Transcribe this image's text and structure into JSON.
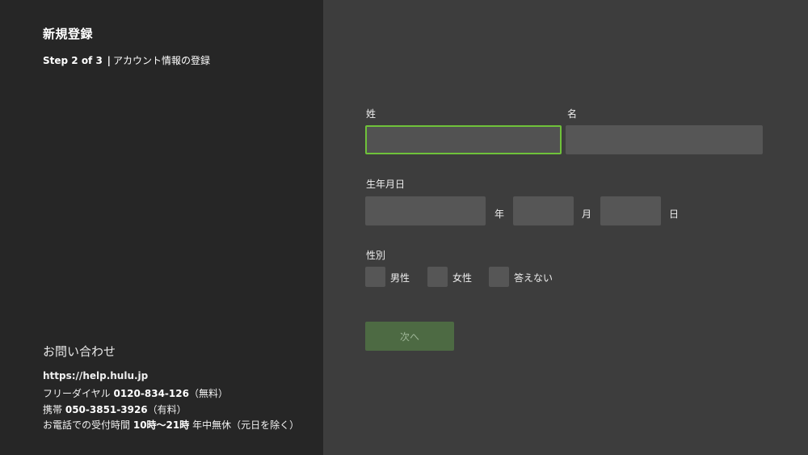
{
  "sidebar": {
    "title": "新規登録",
    "step_count": "Step 2 of 3",
    "step_separator": "|",
    "step_desc": "アカウント情報の登録",
    "contact": {
      "title": "お問い合わせ",
      "url": "https://help.hulu.jp",
      "free_dial_label": "フリーダイヤル",
      "free_dial_number": "0120-834-126",
      "free_dial_note": "（無料）",
      "mobile_label": "携帯",
      "mobile_number": "050-3851-3926",
      "mobile_note": "（有料）",
      "hours_label": "お電話での受付時間",
      "hours_time": "10時〜21時",
      "hours_note": "年中無休（元日を除く）"
    }
  },
  "form": {
    "last_name_label": "姓",
    "last_name_value": "",
    "first_name_label": "名",
    "first_name_value": "",
    "birthdate_label": "生年月日",
    "year_value": "",
    "year_unit": "年",
    "month_value": "",
    "month_unit": "月",
    "day_value": "",
    "day_unit": "日",
    "gender_label": "性別",
    "gender_options": [
      "男性",
      "女性",
      "答えない"
    ],
    "next_button": "次へ"
  },
  "colors": {
    "focus": "#6fc23a",
    "next_button_bg": "#4d6a43"
  }
}
